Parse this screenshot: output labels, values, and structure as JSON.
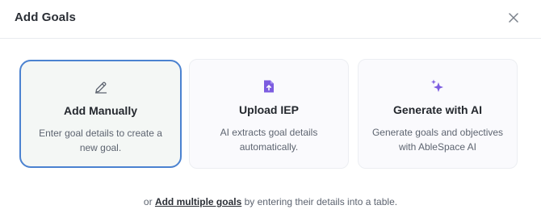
{
  "modal": {
    "title": "Add Goals",
    "close_icon": "close-icon"
  },
  "options": [
    {
      "title": "Add Manually",
      "description": "Enter goal details to create a new goal.",
      "icon": "pencil-icon",
      "selected": true
    },
    {
      "title": "Upload IEP",
      "description": "AI extracts goal details automatically.",
      "icon": "file-upload-icon",
      "selected": false
    },
    {
      "title": "Generate with AI",
      "description": "Generate goals and objectives with AbleSpace AI",
      "icon": "sparkle-icon",
      "selected": false
    }
  ],
  "footer": {
    "prefix": "or",
    "link": "Add multiple goals",
    "suffix": "by entering their details into a table."
  },
  "colors": {
    "selected_border": "#4b82d0",
    "icon_purple": "#7c5ce0"
  }
}
